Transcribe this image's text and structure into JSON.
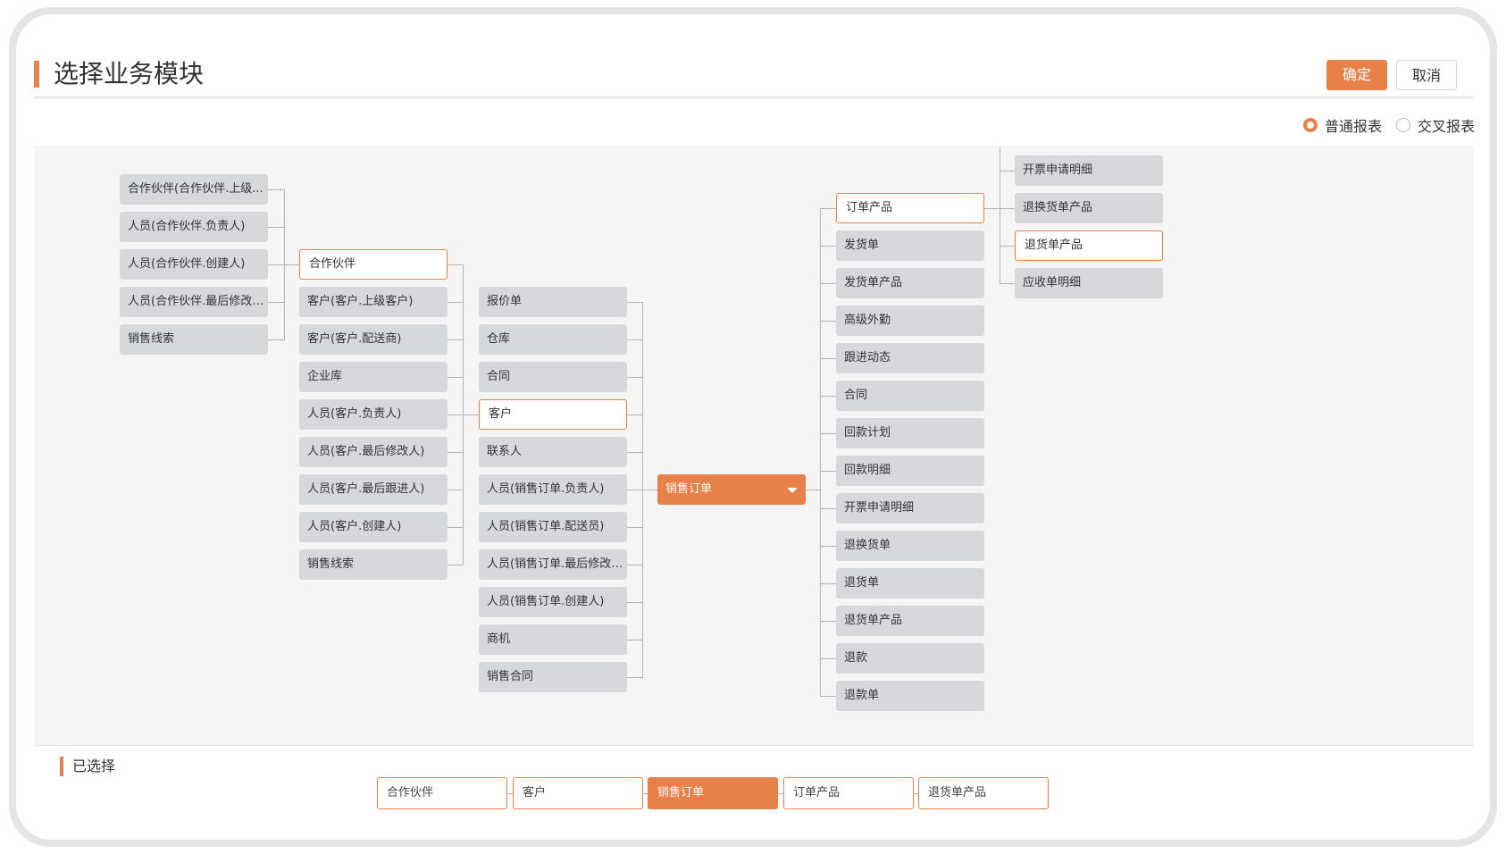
{
  "header": {
    "title": "选择业务模块",
    "confirm_label": "确定",
    "cancel_label": "取消"
  },
  "report_type": {
    "options": [
      {
        "label": "普通报表",
        "selected": true
      },
      {
        "label": "交叉报表",
        "selected": false
      }
    ]
  },
  "tree": {
    "root": {
      "label": "销售订单",
      "icon": "caret-down-icon"
    },
    "col1": [
      "合作伙伴(合作伙伴.上级...",
      "人员(合作伙伴.负责人)",
      "人员(合作伙伴.创建人)",
      "人员(合作伙伴.最后修改人)",
      "销售线索"
    ],
    "col2": [
      "合作伙伴",
      "客户(客户.上级客户)",
      "客户(客户.配送商)",
      "企业库",
      "人员(客户.负责人)",
      "人员(客户.最后修改人)",
      "人员(客户.最后跟进人)",
      "人员(客户.创建人)",
      "销售线索"
    ],
    "col3": [
      "报价单",
      "仓库",
      "合同",
      "客户",
      "联系人",
      "人员(销售订单.负责人)",
      "人员(销售订单.配送员)",
      "人员(销售订单.最后修改人)",
      "人员(销售订单.创建人)",
      "商机",
      "销售合同"
    ],
    "col5": [
      "订单产品",
      "发货单",
      "发货单产品",
      "高级外勤",
      "跟进动态",
      "合同",
      "回款计划",
      "回款明细",
      "开票申请明细",
      "退换货单",
      "退货单",
      "退货单产品",
      "退款",
      "退款单"
    ],
    "col6": [
      "开票申请明细",
      "退换货单产品",
      "退货单产品",
      "应收单明细"
    ],
    "selected": {
      "col2": 0,
      "col3": 3,
      "col5": 0,
      "col6": 2
    }
  },
  "selection": {
    "label": "已选择",
    "chips": [
      "合作伙伴",
      "客户",
      "销售订单",
      "订单产品",
      "退货单产品"
    ],
    "active_index": 2
  },
  "colors": {
    "accent": "#e8804a",
    "node_bg": "#d7d8dc",
    "canvas_bg": "#f5f5f6"
  }
}
